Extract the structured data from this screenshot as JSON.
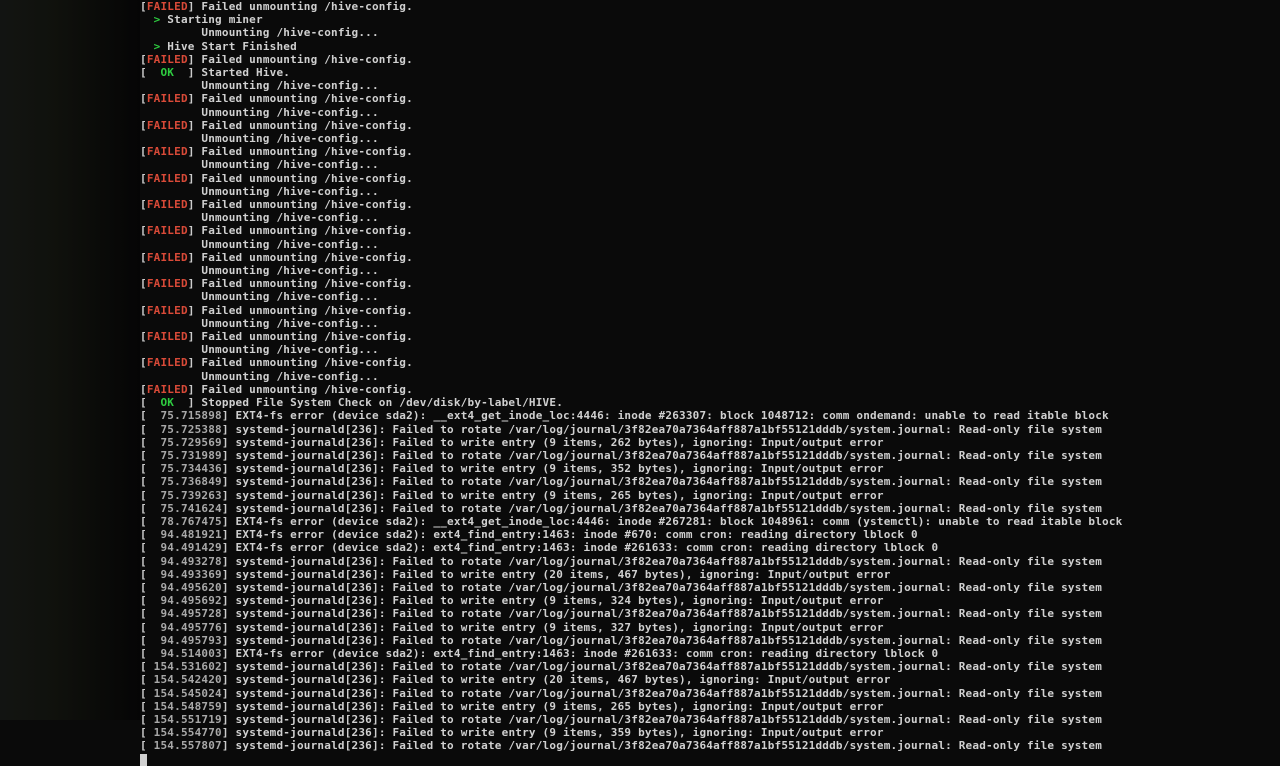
{
  "colors": {
    "failed": "#d94a38",
    "ok": "#2ecc40",
    "text": "#d0d0d0",
    "dim": "#a8a8a8",
    "bg": "#0a0a0a"
  },
  "tokens": {
    "failed": "FAILED",
    "ok": "OK",
    "bracketL": "[",
    "bracketR": "]",
    "gt": ">"
  },
  "lines": [
    {
      "kind": "status",
      "status": "failed",
      "msg": "Failed unmounting /hive-config."
    },
    {
      "kind": "gt",
      "msg": "Starting miner"
    },
    {
      "kind": "cont",
      "msg": "Unmounting /hive-config..."
    },
    {
      "kind": "gt",
      "msg": "Hive Start Finished"
    },
    {
      "kind": "status",
      "status": "failed",
      "msg": "Failed unmounting /hive-config."
    },
    {
      "kind": "status",
      "status": "ok",
      "msg": "Started Hive."
    },
    {
      "kind": "cont",
      "msg": "Unmounting /hive-config..."
    },
    {
      "kind": "status",
      "status": "failed",
      "msg": "Failed unmounting /hive-config."
    },
    {
      "kind": "cont",
      "msg": "Unmounting /hive-config..."
    },
    {
      "kind": "status",
      "status": "failed",
      "msg": "Failed unmounting /hive-config."
    },
    {
      "kind": "cont",
      "msg": "Unmounting /hive-config..."
    },
    {
      "kind": "status",
      "status": "failed",
      "msg": "Failed unmounting /hive-config."
    },
    {
      "kind": "cont",
      "msg": "Unmounting /hive-config..."
    },
    {
      "kind": "status",
      "status": "failed",
      "msg": "Failed unmounting /hive-config."
    },
    {
      "kind": "cont",
      "msg": "Unmounting /hive-config..."
    },
    {
      "kind": "status",
      "status": "failed",
      "msg": "Failed unmounting /hive-config."
    },
    {
      "kind": "cont",
      "msg": "Unmounting /hive-config..."
    },
    {
      "kind": "status",
      "status": "failed",
      "msg": "Failed unmounting /hive-config."
    },
    {
      "kind": "cont",
      "msg": "Unmounting /hive-config..."
    },
    {
      "kind": "status",
      "status": "failed",
      "msg": "Failed unmounting /hive-config."
    },
    {
      "kind": "cont",
      "msg": "Unmounting /hive-config..."
    },
    {
      "kind": "status",
      "status": "failed",
      "msg": "Failed unmounting /hive-config."
    },
    {
      "kind": "cont",
      "msg": "Unmounting /hive-config..."
    },
    {
      "kind": "status",
      "status": "failed",
      "msg": "Failed unmounting /hive-config."
    },
    {
      "kind": "cont",
      "msg": "Unmounting /hive-config..."
    },
    {
      "kind": "status",
      "status": "failed",
      "msg": "Failed unmounting /hive-config."
    },
    {
      "kind": "cont",
      "msg": "Unmounting /hive-config..."
    },
    {
      "kind": "status",
      "status": "failed",
      "msg": "Failed unmounting /hive-config."
    },
    {
      "kind": "cont",
      "msg": "Unmounting /hive-config..."
    },
    {
      "kind": "status",
      "status": "failed",
      "msg": "Failed unmounting /hive-config."
    },
    {
      "kind": "status",
      "status": "ok",
      "msg": "Stopped File System Check on /dev/disk/by-label/HIVE."
    },
    {
      "kind": "kern",
      "ts": "75.715898",
      "msg": "EXT4-fs error (device sda2): __ext4_get_inode_loc:4446: inode #263307: block 1048712: comm ondemand: unable to read itable block"
    },
    {
      "kind": "kern",
      "ts": "75.725388",
      "msg": "systemd-journald[236]: Failed to rotate /var/log/journal/3f82ea70a7364aff887a1bf55121dddb/system.journal: Read-only file system"
    },
    {
      "kind": "kern",
      "ts": "75.729569",
      "msg": "systemd-journald[236]: Failed to write entry (9 items, 262 bytes), ignoring: Input/output error"
    },
    {
      "kind": "kern",
      "ts": "75.731989",
      "msg": "systemd-journald[236]: Failed to rotate /var/log/journal/3f82ea70a7364aff887a1bf55121dddb/system.journal: Read-only file system"
    },
    {
      "kind": "kern",
      "ts": "75.734436",
      "msg": "systemd-journald[236]: Failed to write entry (9 items, 352 bytes), ignoring: Input/output error"
    },
    {
      "kind": "kern",
      "ts": "75.736849",
      "msg": "systemd-journald[236]: Failed to rotate /var/log/journal/3f82ea70a7364aff887a1bf55121dddb/system.journal: Read-only file system"
    },
    {
      "kind": "kern",
      "ts": "75.739263",
      "msg": "systemd-journald[236]: Failed to write entry (9 items, 265 bytes), ignoring: Input/output error"
    },
    {
      "kind": "kern",
      "ts": "75.741624",
      "msg": "systemd-journald[236]: Failed to rotate /var/log/journal/3f82ea70a7364aff887a1bf55121dddb/system.journal: Read-only file system"
    },
    {
      "kind": "kern",
      "ts": "78.767475",
      "msg": "EXT4-fs error (device sda2): __ext4_get_inode_loc:4446: inode #267281: block 1048961: comm (ystemctl): unable to read itable block"
    },
    {
      "kind": "kern",
      "ts": "94.481921",
      "msg": "EXT4-fs error (device sda2): ext4_find_entry:1463: inode #670: comm cron: reading directory lblock 0"
    },
    {
      "kind": "kern",
      "ts": "94.491429",
      "msg": "EXT4-fs error (device sda2): ext4_find_entry:1463: inode #261633: comm cron: reading directory lblock 0"
    },
    {
      "kind": "kern",
      "ts": "94.493278",
      "msg": "systemd-journald[236]: Failed to rotate /var/log/journal/3f82ea70a7364aff887a1bf55121dddb/system.journal: Read-only file system"
    },
    {
      "kind": "kern",
      "ts": "94.493369",
      "msg": "systemd-journald[236]: Failed to write entry (20 items, 467 bytes), ignoring: Input/output error"
    },
    {
      "kind": "kern",
      "ts": "94.495620",
      "msg": "systemd-journald[236]: Failed to rotate /var/log/journal/3f82ea70a7364aff887a1bf55121dddb/system.journal: Read-only file system"
    },
    {
      "kind": "kern",
      "ts": "94.495692",
      "msg": "systemd-journald[236]: Failed to write entry (9 items, 324 bytes), ignoring: Input/output error"
    },
    {
      "kind": "kern",
      "ts": "94.495728",
      "msg": "systemd-journald[236]: Failed to rotate /var/log/journal/3f82ea70a7364aff887a1bf55121dddb/system.journal: Read-only file system"
    },
    {
      "kind": "kern",
      "ts": "94.495776",
      "msg": "systemd-journald[236]: Failed to write entry (9 items, 327 bytes), ignoring: Input/output error"
    },
    {
      "kind": "kern",
      "ts": "94.495793",
      "msg": "systemd-journald[236]: Failed to rotate /var/log/journal/3f82ea70a7364aff887a1bf55121dddb/system.journal: Read-only file system"
    },
    {
      "kind": "kern",
      "ts": "94.514003",
      "msg": "EXT4-fs error (device sda2): ext4_find_entry:1463: inode #261633: comm cron: reading directory lblock 0"
    },
    {
      "kind": "kern",
      "ts": "154.531602",
      "msg": "systemd-journald[236]: Failed to rotate /var/log/journal/3f82ea70a7364aff887a1bf55121dddb/system.journal: Read-only file system"
    },
    {
      "kind": "kern",
      "ts": "154.542420",
      "msg": "systemd-journald[236]: Failed to write entry (20 items, 467 bytes), ignoring: Input/output error"
    },
    {
      "kind": "kern",
      "ts": "154.545024",
      "msg": "systemd-journald[236]: Failed to rotate /var/log/journal/3f82ea70a7364aff887a1bf55121dddb/system.journal: Read-only file system"
    },
    {
      "kind": "kern",
      "ts": "154.548759",
      "msg": "systemd-journald[236]: Failed to write entry (9 items, 265 bytes), ignoring: Input/output error"
    },
    {
      "kind": "kern",
      "ts": "154.551719",
      "msg": "systemd-journald[236]: Failed to rotate /var/log/journal/3f82ea70a7364aff887a1bf55121dddb/system.journal: Read-only file system"
    },
    {
      "kind": "kern",
      "ts": "154.554770",
      "msg": "systemd-journald[236]: Failed to write entry (9 items, 359 bytes), ignoring: Input/output error"
    },
    {
      "kind": "kern",
      "ts": "154.557807",
      "msg": "systemd-journald[236]: Failed to rotate /var/log/journal/3f82ea70a7364aff887a1bf55121dddb/system.journal: Read-only file system"
    }
  ]
}
